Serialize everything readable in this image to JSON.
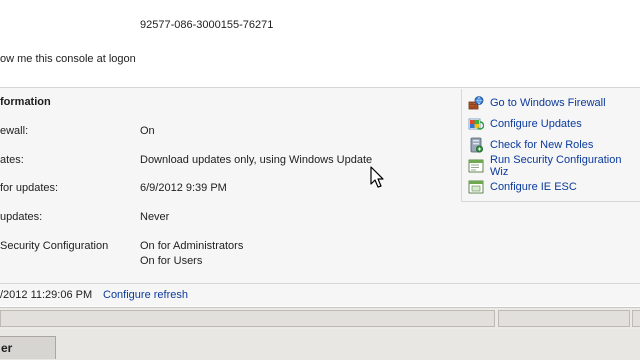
{
  "product_id": "92577-086-3000155-76271",
  "logon_checkbox_label": "ow me this console at logon",
  "security": {
    "heading": "formation",
    "rows": [
      {
        "label": "ewall:",
        "value": "On"
      },
      {
        "label": "ates:",
        "value": "Download updates only, using Windows Update"
      },
      {
        "label": " for updates:",
        "value": "6/9/2012 9:39 PM"
      },
      {
        "label": "updates:",
        "value": "Never"
      },
      {
        "label": "Security Configuration",
        "value": "On for Administrators",
        "value2": "On for Users"
      }
    ]
  },
  "tasks": [
    {
      "label": "Go to Windows Firewall",
      "icon": "firewall-icon"
    },
    {
      "label": "Configure Updates",
      "icon": "updates-icon"
    },
    {
      "label": "Check for New Roles",
      "icon": "roles-icon"
    },
    {
      "label": "Run Security Configuration Wiz",
      "icon": "security-wizard-icon"
    },
    {
      "label": "Configure IE ESC",
      "icon": "ie-esc-icon"
    }
  ],
  "refresh": {
    "timestamp": "/2012 11:29:06 PM",
    "link": "Configure refresh"
  },
  "taskbar": {
    "tab_label": "er"
  },
  "colors": {
    "link": "#0b3a9c",
    "section_bg": "#f6f6f6"
  }
}
